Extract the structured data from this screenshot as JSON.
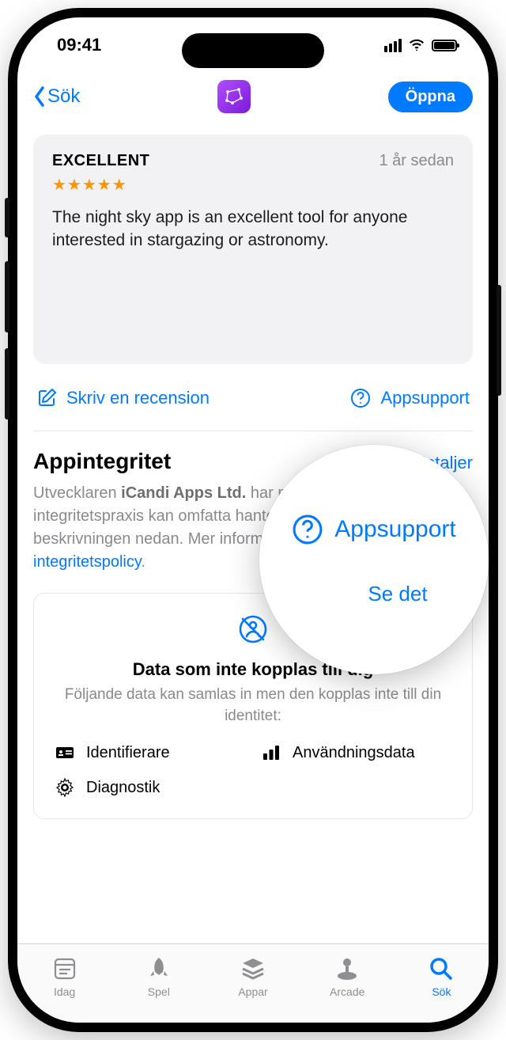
{
  "status": {
    "time": "09:41"
  },
  "nav": {
    "back_label": "Sök",
    "open_label": "Öppna"
  },
  "review": {
    "title": "EXCELLENT",
    "date": "1 år sedan",
    "stars": "★★★★★",
    "body": "The night sky app is an excellent tool for anyone interested in stargazing or astronomy."
  },
  "actions": {
    "write_review": "Skriv en recension",
    "app_support": "Appsupport"
  },
  "privacy": {
    "title": "Appintegritet",
    "see_details": "Se detaljer",
    "text_prefix": "Utvecklaren ",
    "developer": "iCandi Apps Ltd.",
    "text_middle": " har meddelat att appens integritetspraxis kan omfatta hantering av data enligt beskrivningen nedan. Mer information finns i ",
    "policy_link": "utvecklarens integritetspolicy",
    "text_suffix": "."
  },
  "data_card": {
    "title": "Data som inte kopplas till dig",
    "subtitle": "Följande data kan samlas in men den kopplas inte till din identitet:",
    "items": {
      "identifiers": "Identifierare",
      "usage": "Användningsdata",
      "diagnostics": "Diagnostik"
    }
  },
  "tabs": {
    "today": "Idag",
    "games": "Spel",
    "apps": "Appar",
    "arcade": "Arcade",
    "search": "Sök"
  },
  "magnifier": {
    "label": "Appsupport",
    "detail_fragment": "Se det"
  }
}
